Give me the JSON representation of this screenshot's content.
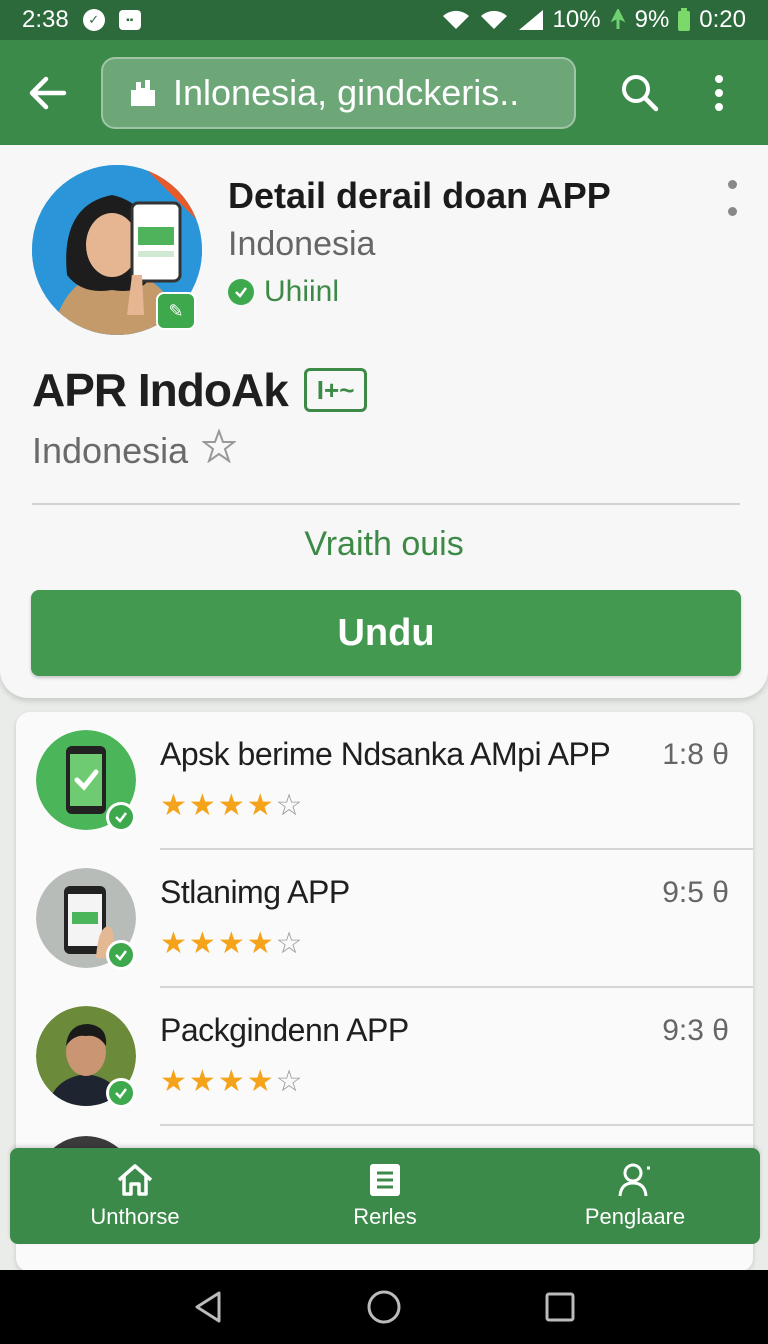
{
  "status_bar": {
    "time": "2:38",
    "signal_text": "10%",
    "battery_text": "9%",
    "clock_right": "0:20"
  },
  "app_bar": {
    "search_value": "Inlonesia, gindckeris.."
  },
  "detail": {
    "title": "Detail derail doan APP",
    "subtitle": "Indonesia",
    "verified_label": "Uhiinl",
    "app_name": "APR IndoAk",
    "tag_label": "I+~",
    "country": "Indonesia",
    "link_label": "Vraith ouis",
    "primary_button": "Undu"
  },
  "list": [
    {
      "title": "Apsk berime Ndsanka AMpi APP",
      "rating": 4,
      "time": "1:8",
      "avatar": "phone-check"
    },
    {
      "title": "Stlanimg APP",
      "rating": 4,
      "time": "9:5",
      "avatar": "phone-hand"
    },
    {
      "title": "Packgindenn APP",
      "rating": 4,
      "time": "9:3",
      "avatar": "man"
    }
  ],
  "bottom_nav": [
    {
      "label": "Unthorse",
      "icon": "home-icon"
    },
    {
      "label": "Rerles",
      "icon": "document-icon"
    },
    {
      "label": "Penglaare",
      "icon": "person-icon"
    }
  ],
  "colors": {
    "primary": "#3c8a4a",
    "status_bar": "#2c6a3b",
    "button": "#43994f",
    "star": "#f4a31a"
  }
}
